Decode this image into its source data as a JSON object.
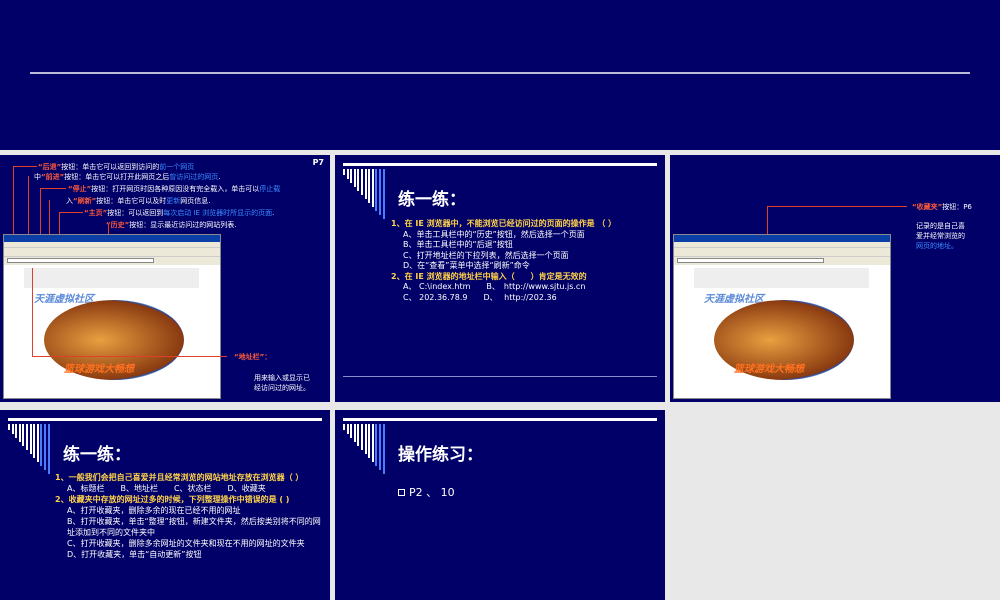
{
  "slide1": {
    "page": "P7",
    "back": [
      "“后退”",
      "按钮：单击它可以返回到访问的",
      "前一个网页"
    ],
    "forward": [
      "中",
      "“前进”",
      "按钮：单击它可以打开此网页之后",
      "曾访问过的网页",
      "."
    ],
    "stop": [
      "“停止”",
      "按钮：打开网页时因各种原因没有完全载入，单击可以",
      "停止载"
    ],
    "refresh": [
      "入",
      "“刷新”",
      "按钮：单击它可以及时",
      "更新",
      "网页信息."
    ],
    "home": [
      "“主页”",
      "按钮：可以返回到",
      "每次启动 IE 浏览器时所显示的页面",
      "."
    ],
    "history": [
      "“历史”",
      "按钮：显示最近访问过的网站列表."
    ],
    "address_label": "“地址栏”：",
    "address_desc": [
      "用来输入或显示已",
      "经访问过的网址。"
    ],
    "browser_banner": "篮球游戏大畅想",
    "browser_logo": "天涯虚拟社区"
  },
  "slide2": {
    "title": "练一练：",
    "q1": "1、在 IE 浏览器中，不能浏览已经访问过的页面的操作是 （ ）",
    "q1_options": [
      "A、单击工具栏中的“历史”按钮，然后选择一个页面",
      "B、单击工具栏中的“后退”按钮",
      "C、打开地址栏的下拉列表，然后选择一个页面",
      "D、在“查看”菜单中选择“刷新”命令"
    ],
    "q2": "2、在 IE 浏览器的地址栏中输入（　　）肯定是无效的",
    "q2_options": [
      "A、 C:\\index.htm　　B、　http://www.sjtu.js.cn",
      "C、 202.36.78.9　　D、　 http://202.36"
    ]
  },
  "slide3": {
    "label": "“收藏夹”",
    "label_rest": "按钮：P6",
    "desc": [
      "记录的是自己喜",
      "爱并经常浏览的"
    ],
    "desc_blue": "网页的地址。",
    "browser_banner": "篮球游戏大畅想",
    "browser_logo": "天涯虚拟社区"
  },
  "slide4": {
    "title": "练一练：",
    "q1": "1、一般我们会把自己喜爱并且经常浏览的网站地址存放在浏览器（ ）",
    "q1_options": "A、标题栏　　B、地址栏　　C、状态栏　　D、收藏夹",
    "q2": "2、收藏夹中存放的网址过多的时候，下列整理操作中错误的是 ( )",
    "q2_options": [
      "A、打开收藏夹，删除多余的现在已经不用的网址",
      "B、打开收藏夹，单击“整理”按钮，新建文件夹，然后按类别将不同的网址添加到不同的文件夹中",
      "C、打开收藏夹，删除多余网址的文件夹和现在不用的网址的文件夹",
      "D、打开收藏夹，单击“自动更新”按钮"
    ]
  },
  "slide5": {
    "title": "操作练习：",
    "bullet": "P2 、 10"
  }
}
